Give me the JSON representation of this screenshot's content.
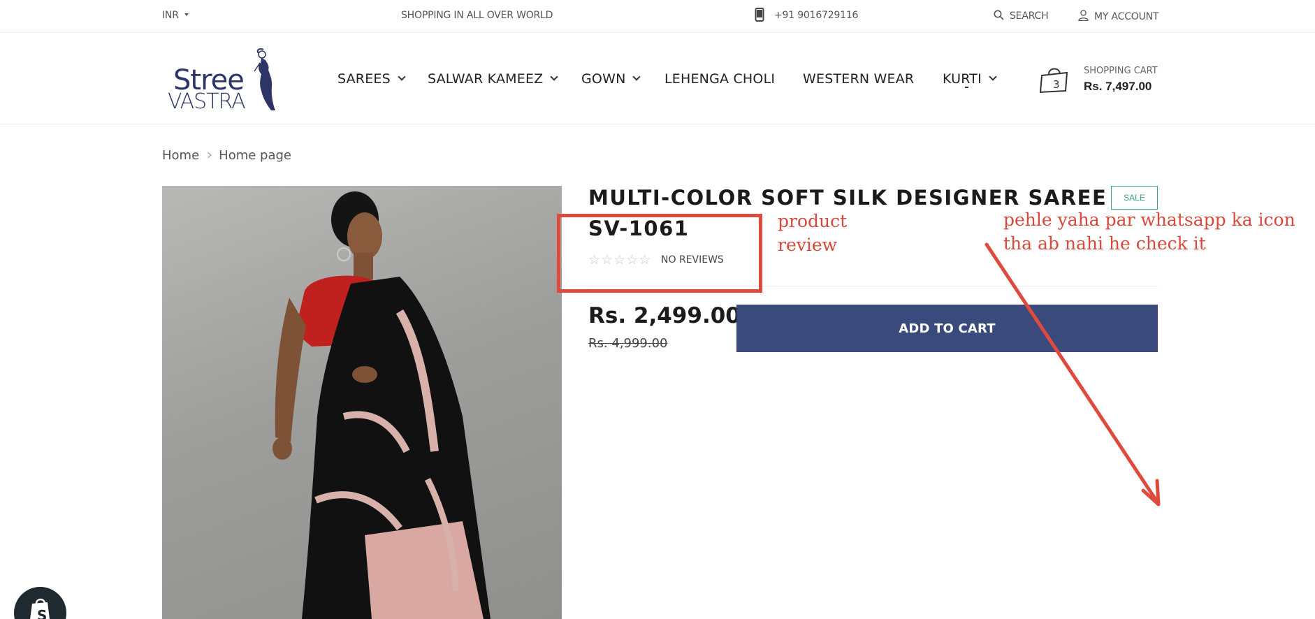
{
  "topbar": {
    "currency": "INR",
    "shipping_text": "SHOPPING IN ALL OVER WORLD",
    "phone": "+91 9016729116",
    "search_label": "SEARCH",
    "account_label": "MY ACCOUNT"
  },
  "header": {
    "logo": {
      "line1": "Stree",
      "line2": "VASTRA"
    },
    "nav": [
      {
        "label": "SAREES",
        "has_dropdown": true
      },
      {
        "label": "SALWAR KAMEEZ",
        "has_dropdown": true
      },
      {
        "label": "GOWN",
        "has_dropdown": true
      },
      {
        "label": "LEHENGA CHOLI",
        "has_dropdown": false
      },
      {
        "label": "WESTERN WEAR",
        "has_dropdown": false
      },
      {
        "label": "KURTI",
        "has_dropdown": true
      }
    ],
    "cart": {
      "count": "3",
      "label": "SHOPPING CART",
      "total": "Rs. 7,497.00"
    }
  },
  "breadcrumb": [
    "Home",
    "Home page"
  ],
  "product": {
    "title": "MULTI-COLOR SOFT SILK DESIGNER SAREE",
    "sku": "SV-1061",
    "badge": "SALE",
    "rating_stars": 0,
    "reviews_text": "NO REVIEWS",
    "price": "Rs. 2,499.00",
    "compare_price": "Rs. 4,999.00",
    "add_to_cart_label": "ADD TO CART"
  },
  "annotations": {
    "note1": "product review",
    "note2": "pehle yaha par whatsapp ka icon tha ab nahi he check it",
    "color": "#e04a3d"
  },
  "colors": {
    "button": "#3a4a7d",
    "sale": "#3aa676",
    "logo": "#2c3566"
  },
  "icons": [
    "caret-down-icon",
    "phone-icon",
    "search-icon",
    "user-icon",
    "chevron-down-icon",
    "shopping-bag-icon",
    "star-icon",
    "shopify-icon"
  ]
}
